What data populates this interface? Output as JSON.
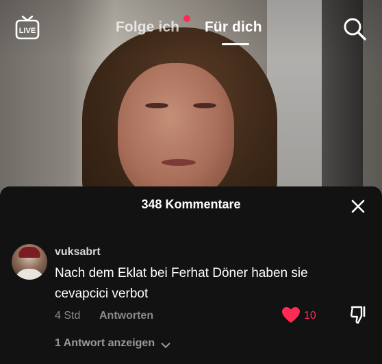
{
  "header": {
    "live_icon": "live-tv-icon",
    "tabs": [
      {
        "label": "Folge ich",
        "active": false,
        "has_notification": true
      },
      {
        "label": "Für dich",
        "active": true
      }
    ],
    "search_icon": "search-icon"
  },
  "comments": {
    "title": "348 Kommentare",
    "close_icon": "close-icon",
    "items": [
      {
        "username": "vuksabrt",
        "text": "Nach dem Eklat bei Ferhat Döner haben sie cevapcici verbot",
        "time": "4 Std",
        "reply_label": "Antworten",
        "likes": "10",
        "liked": true,
        "show_replies_label": "1 Antwort anzeigen"
      }
    ]
  },
  "colors": {
    "accent": "#fe2c55",
    "sheet_bg": "#121212",
    "muted_text": "#8a8a8a"
  }
}
